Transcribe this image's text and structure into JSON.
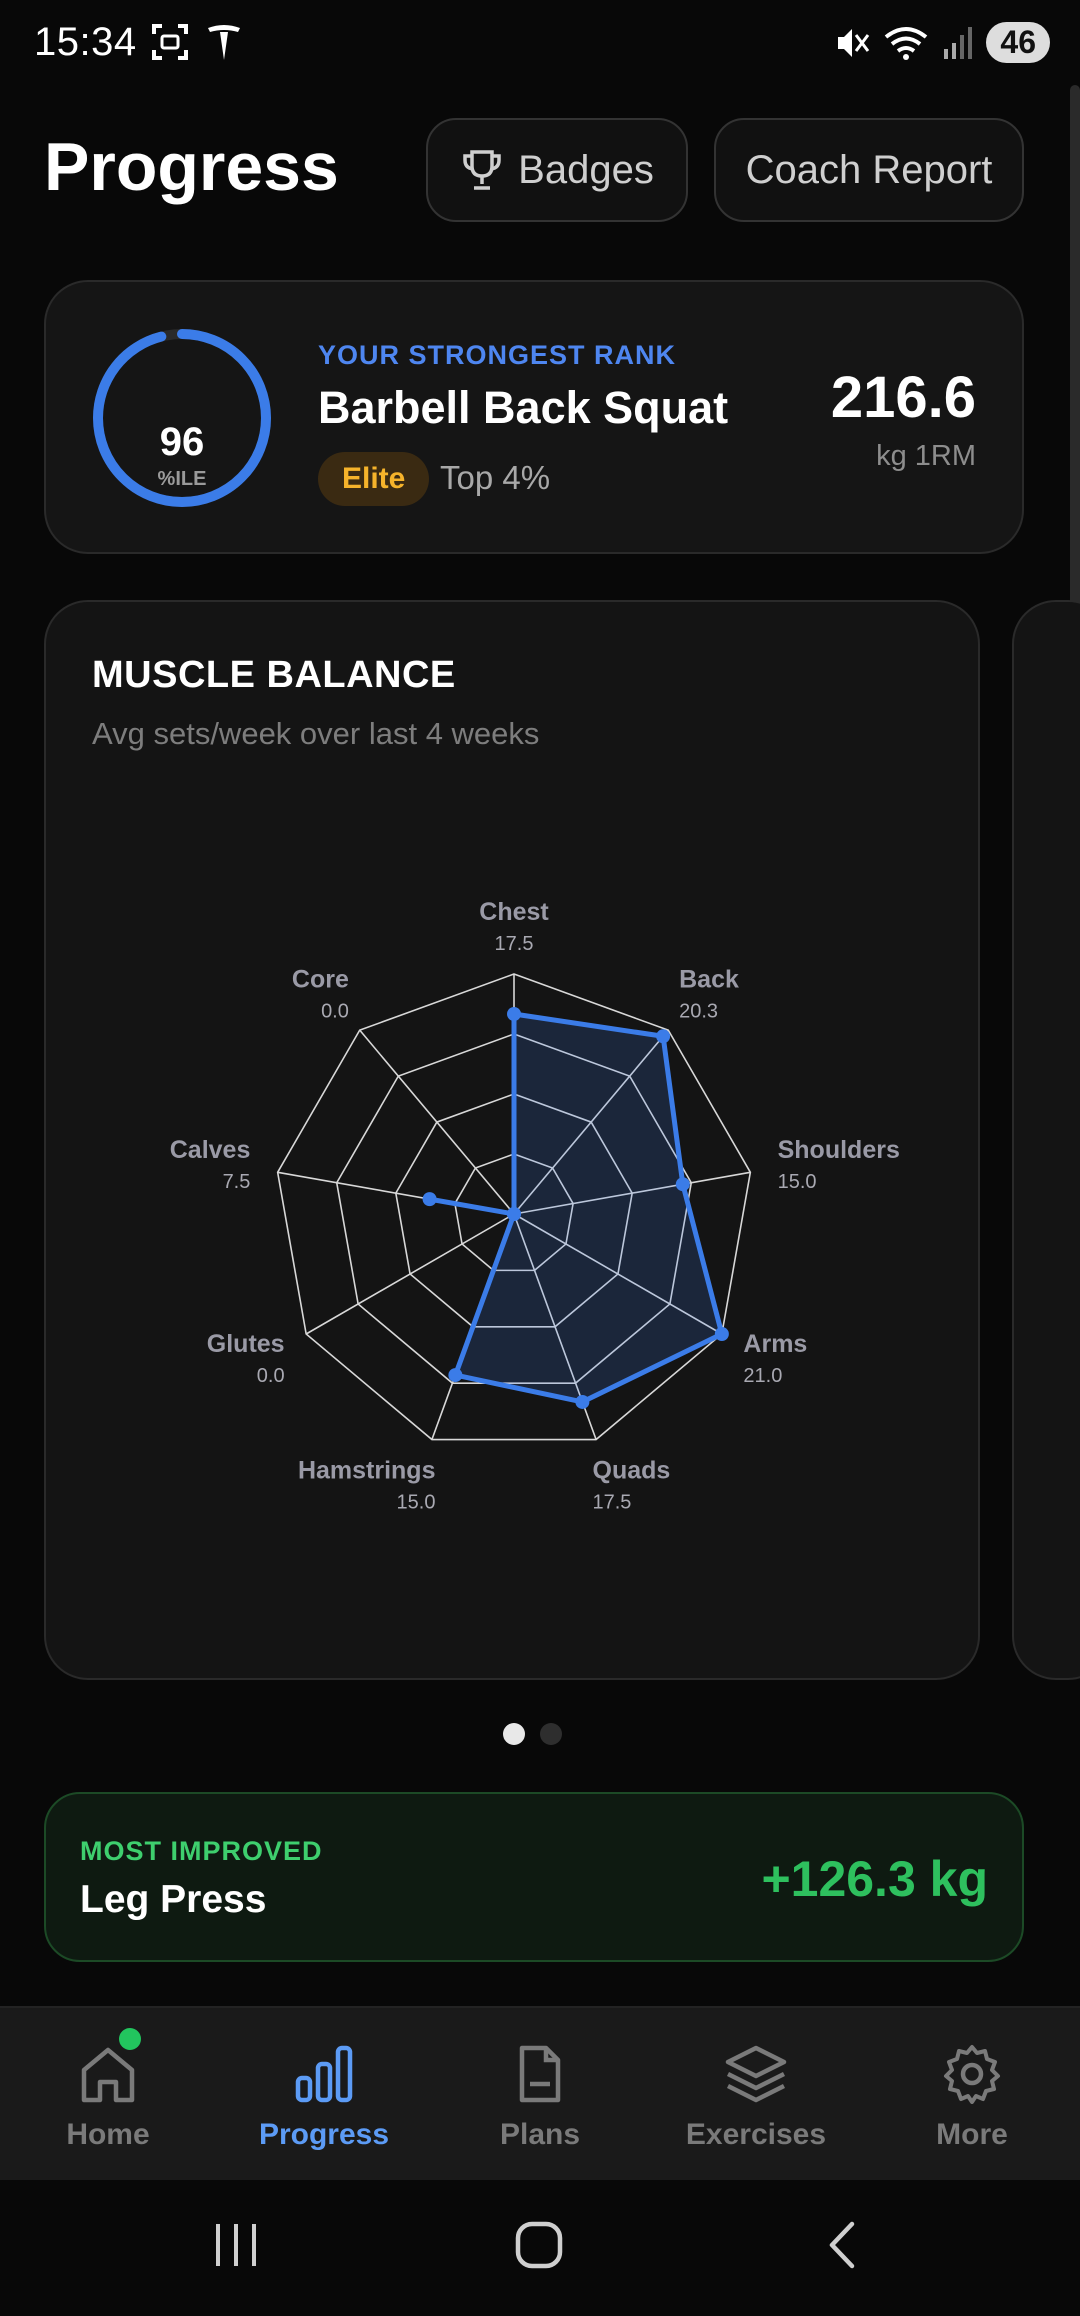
{
  "status_bar": {
    "time": "15:34",
    "battery": "46"
  },
  "header": {
    "title": "Progress",
    "badges_label": "Badges",
    "coach_report_label": "Coach Report"
  },
  "rank_card": {
    "percentile": "96",
    "percentile_unit": "%ILE",
    "percentile_fraction": 0.96,
    "label": "YOUR STRONGEST RANK",
    "exercise": "Barbell Back Squat",
    "tier": "Elite",
    "top_text": "Top 4%",
    "value": "216.6",
    "unit": "kg 1RM"
  },
  "muscle_balance": {
    "title": "MUSCLE BALANCE",
    "subtitle": "Avg sets/week over last 4 weeks",
    "chart_data": {
      "type": "radar",
      "categories": [
        "Chest",
        "Back",
        "Shoulders",
        "Arms",
        "Quads",
        "Hamstrings",
        "Glutes",
        "Calves",
        "Core"
      ],
      "value_labels": [
        "17.5",
        "20.3",
        "15.0",
        "21.0",
        "17.5",
        "15.0",
        "0.0",
        "7.5",
        "0.0"
      ],
      "values": [
        17.5,
        20.3,
        15.0,
        21.0,
        17.5,
        15.0,
        0.0,
        7.5,
        0.0
      ],
      "rmax": 21.0,
      "rings": 4
    }
  },
  "pager": {
    "count": 2,
    "active": 0
  },
  "most_improved": {
    "label": "MOST IMPROVED",
    "exercise": "Leg Press",
    "value": "+126.3 kg"
  },
  "bottom_nav": {
    "items": [
      {
        "label": "Home",
        "icon": "home-icon"
      },
      {
        "label": "Progress",
        "icon": "bar-chart-icon"
      },
      {
        "label": "Plans",
        "icon": "document-icon"
      },
      {
        "label": "Exercises",
        "icon": "layers-icon"
      },
      {
        "label": "More",
        "icon": "gear-icon"
      }
    ],
    "active": "Progress"
  },
  "colors": {
    "accent": "#3b7ce8",
    "elite": "#f5b32b",
    "improve": "#2ec05e",
    "notification": "#22c55e"
  }
}
